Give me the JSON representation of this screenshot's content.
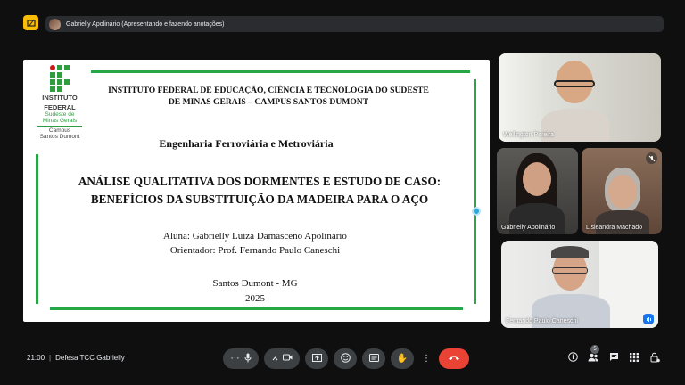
{
  "header": {
    "presenting_text": "Gabrielly Apolinário (Apresentando e fazendo anotações)",
    "present_icon": "presentation-icon"
  },
  "slide": {
    "logo": {
      "line1": "INSTITUTO",
      "line2": "FEDERAL",
      "line3": "Sudeste de",
      "line4": "Minas Gerais",
      "line5": "Campus",
      "line6": "Santos Dumont"
    },
    "institution": "INSTITUTO FEDERAL DE EDUCAÇÃO, CIÊNCIA E TECNOLOGIA DO SUDESTE DE MINAS GERAIS – CAMPUS SANTOS DUMONT",
    "course": "Engenharia Ferroviária e Metroviária",
    "title": "ANÁLISE QUALITATIVA DOS DORMENTES E ESTUDO DE CASO: BENEFÍCIOS DA SUBSTITUIÇÃO DA MADEIRA PARA O AÇO",
    "student": "Aluna: Gabrielly Luiza Damasceno Apolinário",
    "advisor": "Orientador: Prof. Fernando Paulo Caneschi",
    "city": "Santos Dumont - MG",
    "year": "2025",
    "accent_color": "#28a745"
  },
  "participants": [
    {
      "name": "Wellington Pereira",
      "icon": ""
    },
    {
      "name": "Gabrielly Apolinário",
      "icon": ""
    },
    {
      "name": "Lisleandra Machado",
      "icon": "mic-off-icon"
    },
    {
      "name": "Fernando Paulo Caneschi",
      "icon": "speaking-icon"
    }
  ],
  "bottom": {
    "time": "21:00",
    "meeting_name": "Defesa TCC Gabrielly",
    "people_count": "5",
    "end_call_color": "#ea4335"
  }
}
